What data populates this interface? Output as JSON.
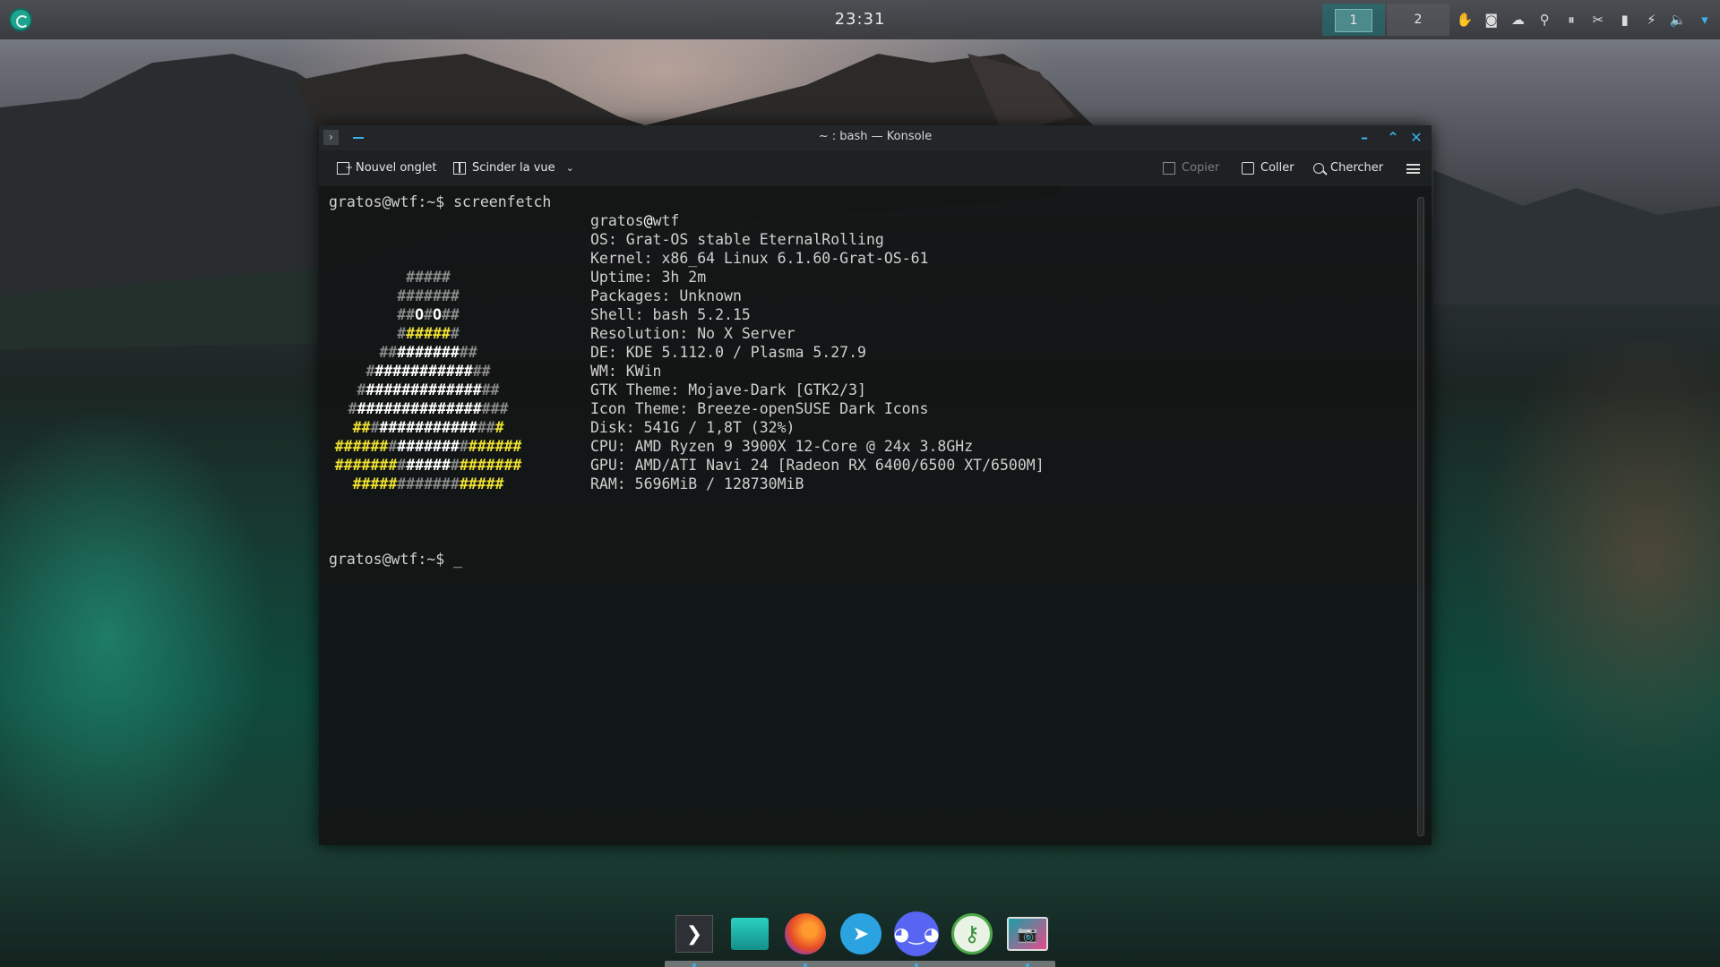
{
  "panel": {
    "clock": "23:31",
    "desktops": [
      "1",
      "2"
    ],
    "active_desktop": "1",
    "tray_icons": [
      "red-app-icon",
      "discord-tray-icon",
      "cloud-sync-icon",
      "location-icon",
      "media-pause-icon",
      "kdeconnect-icon",
      "usb-device-icon",
      "network-icon",
      "volume-icon",
      "tray-expand-icon"
    ]
  },
  "window": {
    "title": "~ : bash — Konsole",
    "toolbar": {
      "new_tab": "Nouvel onglet",
      "split_view": "Scinder la vue",
      "copy": "Copier",
      "paste": "Coller",
      "search": "Chercher"
    }
  },
  "terminal": {
    "prompt1": "gratos@wtf:~$ screenfetch",
    "user": "gratos",
    "at": "@",
    "host": "wtf",
    "info": [
      "OS: Grat-OS stable EternalRolling",
      "Kernel: x86_64 Linux 6.1.60-Grat-OS-61",
      "Uptime: 3h 2m",
      "Packages: Unknown",
      "Shell: bash 5.2.15",
      "Resolution: No X Server",
      "DE: KDE 5.112.0 / Plasma 5.27.9",
      "WM: KWin",
      "GTK Theme: Mojave-Dark [GTK2/3]",
      "Icon Theme: Breeze-openSUSE Dark Icons",
      "Disk: 541G / 1,8T (32%)",
      "CPU: AMD Ryzen 9 3900X 12-Core @ 24x 3.8GHz",
      "GPU: AMD/ATI Navi 24 [Radeon RX 6400/6500 XT/6500M]",
      "RAM: 5696MiB / 128730MiB"
    ],
    "prompt2": "gratos@wtf:~$ _",
    "logo": [
      [
        [
          "g",
          "#####"
        ]
      ],
      [
        [
          "g",
          "#######"
        ]
      ],
      [
        [
          "g",
          "##"
        ],
        [
          "w",
          "O"
        ],
        [
          "g",
          "#"
        ],
        [
          "w",
          "O"
        ],
        [
          "g",
          "##"
        ]
      ],
      [
        [
          "g",
          "#"
        ],
        [
          "y",
          "#####"
        ],
        [
          "g",
          "#"
        ]
      ],
      [
        [
          "g",
          "##"
        ],
        [
          "w",
          "#######"
        ],
        [
          "g",
          "##"
        ]
      ],
      [
        [
          "g",
          "#"
        ],
        [
          "w",
          "###########"
        ],
        [
          "g",
          "##"
        ]
      ],
      [
        [
          "g",
          "#"
        ],
        [
          "w",
          "#############"
        ],
        [
          "g",
          "##"
        ]
      ],
      [
        [
          "g",
          "#"
        ],
        [
          "w",
          "##############"
        ],
        [
          "g",
          "###"
        ]
      ],
      [
        [
          "y",
          "##"
        ],
        [
          "g",
          "#"
        ],
        [
          "w",
          "###########"
        ],
        [
          "g",
          "##"
        ],
        [
          "y",
          "#"
        ]
      ],
      [
        [
          "y",
          "######"
        ],
        [
          "g",
          "#"
        ],
        [
          "w",
          "#######"
        ],
        [
          "g",
          "#"
        ],
        [
          "y",
          "######"
        ]
      ],
      [
        [
          "y",
          "#######"
        ],
        [
          "g",
          "#"
        ],
        [
          "w",
          "#####"
        ],
        [
          "g",
          "#"
        ],
        [
          "y",
          "#######"
        ]
      ],
      [
        [
          "y",
          "#####"
        ],
        [
          "g",
          "#######"
        ],
        [
          "y",
          "#####"
        ]
      ]
    ]
  },
  "dock": [
    {
      "name": "dock-terminal",
      "glyph": "❯"
    },
    {
      "name": "dock-files",
      "glyph": ""
    },
    {
      "name": "dock-firefox",
      "glyph": ""
    },
    {
      "name": "dock-telegram",
      "glyph": "➤"
    },
    {
      "name": "dock-discord",
      "glyph": "◕‿◕"
    },
    {
      "name": "dock-keepass",
      "glyph": "⚷"
    },
    {
      "name": "dock-screenshot",
      "glyph": "📷"
    }
  ]
}
